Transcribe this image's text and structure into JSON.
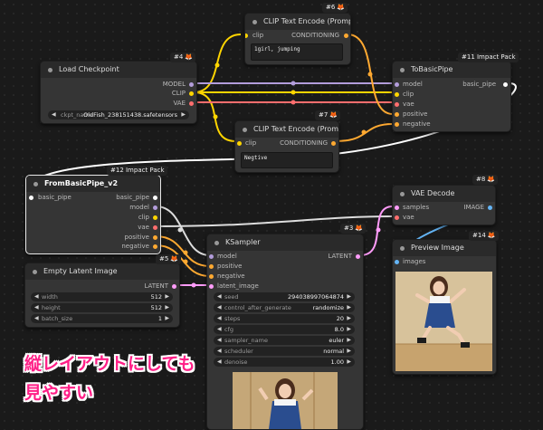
{
  "colors": {
    "model": "#b39ddb",
    "clip": "#ffd500",
    "vae": "#ff6e6e",
    "conditioning": "#ffa931",
    "latent": "#ff9cf9",
    "image": "#64b5f6",
    "basic_pipe": "#ffffff",
    "caption": "#ff1f87"
  },
  "nodes": {
    "clip_text_pos": {
      "badge": "#6",
      "title": "CLIP Text Encode (Prompt)",
      "input": "clip",
      "output": "CONDITIONING",
      "text": "1girl, jumping"
    },
    "load_checkpoint": {
      "badge": "#4",
      "title": "Load Checkpoint",
      "outputs": [
        "MODEL",
        "CLIP",
        "VAE"
      ],
      "widget_label": "ckpt_name",
      "widget_value": "OldFish_238151438.safetensors"
    },
    "to_basic_pipe": {
      "badge": "#11 Impact Pack",
      "title": "ToBasicPipe",
      "inputs": [
        "model",
        "clip",
        "vae",
        "positive",
        "negative"
      ],
      "output": "basic_pipe"
    },
    "clip_text_neg": {
      "badge": "#7",
      "title": "CLIP Text Encode (Prompt)",
      "input": "clip",
      "output": "CONDITIONING",
      "text": "Negtive"
    },
    "from_basic_pipe": {
      "badge": "#12 Impact Pack",
      "title": "FromBasicPipe_v2",
      "input": "basic_pipe",
      "outputs": [
        "basic_pipe",
        "model",
        "clip",
        "vae",
        "positive",
        "negative"
      ]
    },
    "vae_decode": {
      "badge": "#8",
      "title": "VAE Decode",
      "inputs": [
        "samples",
        "vae"
      ],
      "output": "IMAGE"
    },
    "ksampler": {
      "badge": "#3",
      "title": "KSampler",
      "inputs": [
        "model",
        "positive",
        "negative",
        "latent_image"
      ],
      "output": "LATENT",
      "widgets": [
        {
          "label": "seed",
          "value": "294038997064874"
        },
        {
          "label": "control_after_generate",
          "value": "randomize"
        },
        {
          "label": "steps",
          "value": "20"
        },
        {
          "label": "cfg",
          "value": "8.0"
        },
        {
          "label": "sampler_name",
          "value": "euler"
        },
        {
          "label": "scheduler",
          "value": "normal"
        },
        {
          "label": "denoise",
          "value": "1.00"
        }
      ]
    },
    "preview_image": {
      "badge": "#14",
      "title": "Preview Image",
      "input": "images"
    },
    "empty_latent": {
      "badge": "#5",
      "title": "Empty Latent Image",
      "output": "LATENT",
      "widgets": [
        {
          "label": "width",
          "value": "512"
        },
        {
          "label": "height",
          "value": "512"
        },
        {
          "label": "batch_size",
          "value": "1"
        }
      ]
    }
  },
  "caption": {
    "line1": "縦レイアウトにしても",
    "line2": "見やすい"
  }
}
